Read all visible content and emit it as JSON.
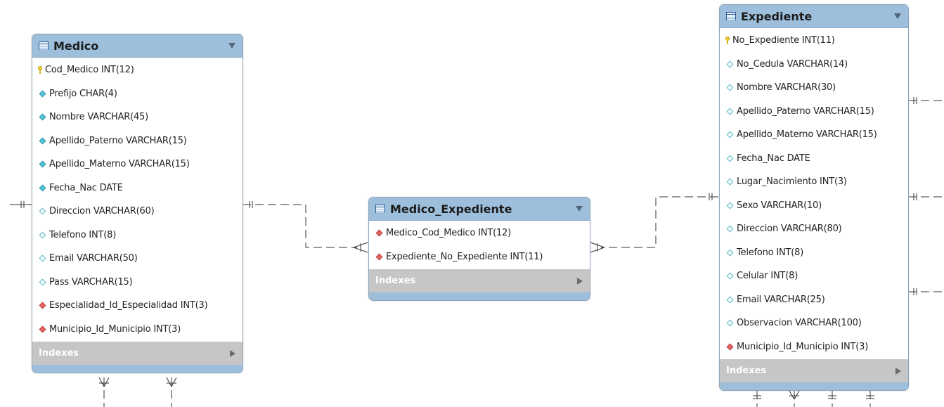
{
  "tables": [
    {
      "id": "medico",
      "title": "Medico",
      "indexes_label": "Indexes",
      "columns": [
        {
          "text": "Cod_Medico INT(12)",
          "marker": "key"
        },
        {
          "text": "Prefijo CHAR(4)",
          "marker": "filled"
        },
        {
          "text": "Nombre VARCHAR(45)",
          "marker": "filled"
        },
        {
          "text": "Apellido_Paterno VARCHAR(15)",
          "marker": "filled"
        },
        {
          "text": "Apellido_Materno VARCHAR(15)",
          "marker": "filled"
        },
        {
          "text": "Fecha_Nac DATE",
          "marker": "filled"
        },
        {
          "text": "Direccion VARCHAR(60)",
          "marker": "empty"
        },
        {
          "text": "Telefono INT(8)",
          "marker": "empty"
        },
        {
          "text": "Email VARCHAR(50)",
          "marker": "empty"
        },
        {
          "text": "Pass VARCHAR(15)",
          "marker": "empty"
        },
        {
          "text": "Especialidad_Id_Especialidad INT(3)",
          "marker": "fk"
        },
        {
          "text": "Municipio_Id_Municipio INT(3)",
          "marker": "fk"
        }
      ]
    },
    {
      "id": "medico_expediente",
      "title": "Medico_Expediente",
      "indexes_label": "Indexes",
      "columns": [
        {
          "text": "Medico_Cod_Medico INT(12)",
          "marker": "fk"
        },
        {
          "text": "Expediente_No_Expediente INT(11)",
          "marker": "fk"
        }
      ]
    },
    {
      "id": "expediente",
      "title": "Expediente",
      "indexes_label": "Indexes",
      "columns": [
        {
          "text": "No_Expediente INT(11)",
          "marker": "key"
        },
        {
          "text": "No_Cedula VARCHAR(14)",
          "marker": "empty"
        },
        {
          "text": "Nombre VARCHAR(30)",
          "marker": "empty"
        },
        {
          "text": "Apellido_Paterno VARCHAR(15)",
          "marker": "empty"
        },
        {
          "text": "Apellido_Materno VARCHAR(15)",
          "marker": "empty"
        },
        {
          "text": "Fecha_Nac DATE",
          "marker": "empty"
        },
        {
          "text": "Lugar_Nacimiento INT(3)",
          "marker": "empty"
        },
        {
          "text": "Sexo VARCHAR(10)",
          "marker": "empty"
        },
        {
          "text": "Direccion VARCHAR(80)",
          "marker": "empty"
        },
        {
          "text": "Telefono INT(8)",
          "marker": "empty"
        },
        {
          "text": "Celular INT(8)",
          "marker": "empty"
        },
        {
          "text": "Email VARCHAR(25)",
          "marker": "empty"
        },
        {
          "text": "Observacion VARCHAR(100)",
          "marker": "empty"
        },
        {
          "text": "Municipio_Id_Municipio INT(3)",
          "marker": "fk"
        }
      ]
    }
  ],
  "relationships": [
    {
      "from": "Medico",
      "to": "Medico_Expediente",
      "cardinality": "one-to-many"
    },
    {
      "from": "Expediente",
      "to": "Medico_Expediente",
      "cardinality": "one-to-many"
    }
  ],
  "colors": {
    "header": "#9dbfdc",
    "indexes": "#c6c6c6",
    "primary_key": "#f0cf2d",
    "column_marker": "#55c5d9",
    "foreign_key": "#e36767",
    "line": "#333333"
  }
}
